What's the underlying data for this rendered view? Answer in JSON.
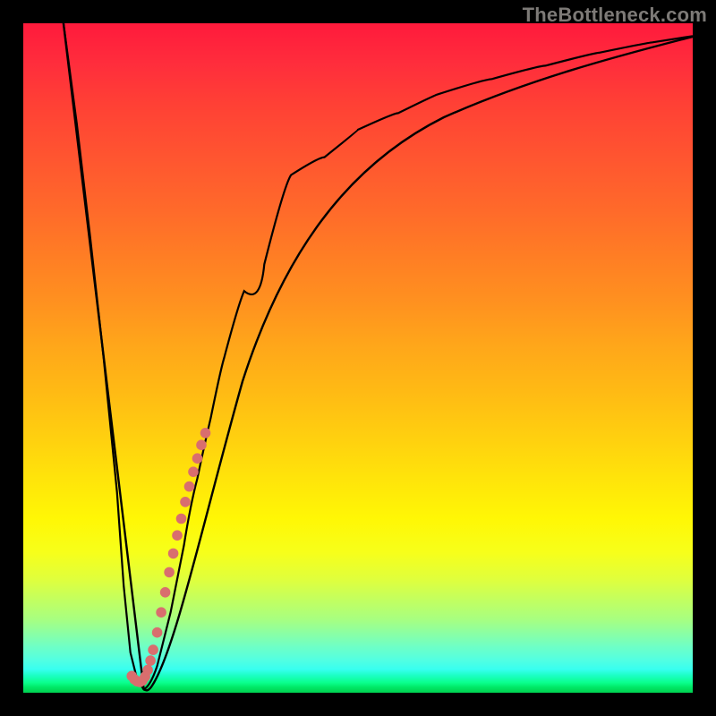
{
  "watermark": "TheBottleneck.com",
  "colors": {
    "frame": "#000000",
    "curve_stroke": "#000000",
    "highlight_stroke": "#d96e6e",
    "gradient_top": "#ff1a3c",
    "gradient_bottom": "#00d050"
  },
  "chart_data": {
    "type": "line",
    "title": "",
    "xlabel": "",
    "ylabel": "",
    "xlim": [
      0,
      100
    ],
    "ylim": [
      0,
      100
    ],
    "grid": false,
    "legend": false,
    "series": [
      {
        "name": "bottleneck-curve",
        "x": [
          6,
          8,
          10,
          12,
          14,
          15,
          16,
          17,
          18,
          20,
          22,
          24,
          26,
          28,
          30,
          33,
          36,
          40,
          45,
          50,
          56,
          62,
          70,
          78,
          86,
          94,
          100
        ],
        "y": [
          100,
          85,
          68,
          50,
          30,
          16,
          6,
          2,
          0.5,
          4,
          12,
          22,
          32,
          41,
          49,
          58,
          64,
          70,
          76,
          80,
          84,
          86.5,
          89,
          90.7,
          92,
          93,
          93.4
        ]
      },
      {
        "name": "highlight-dots",
        "x": [
          16.2,
          16.6,
          17.0,
          17.4,
          17.8,
          18.2,
          18.6,
          19.0,
          19.4,
          20.0,
          20.6,
          21.2,
          21.8,
          22.4,
          23.0,
          23.6,
          24.2,
          24.8,
          25.4,
          26.0,
          26.6,
          27.2
        ],
        "y": [
          2.5,
          2.0,
          1.7,
          1.6,
          1.8,
          2.4,
          3.4,
          4.8,
          6.4,
          9.0,
          12.0,
          15.0,
          18.0,
          20.8,
          23.5,
          26.0,
          28.5,
          30.8,
          33.0,
          35.0,
          37.0,
          38.8
        ]
      }
    ]
  }
}
